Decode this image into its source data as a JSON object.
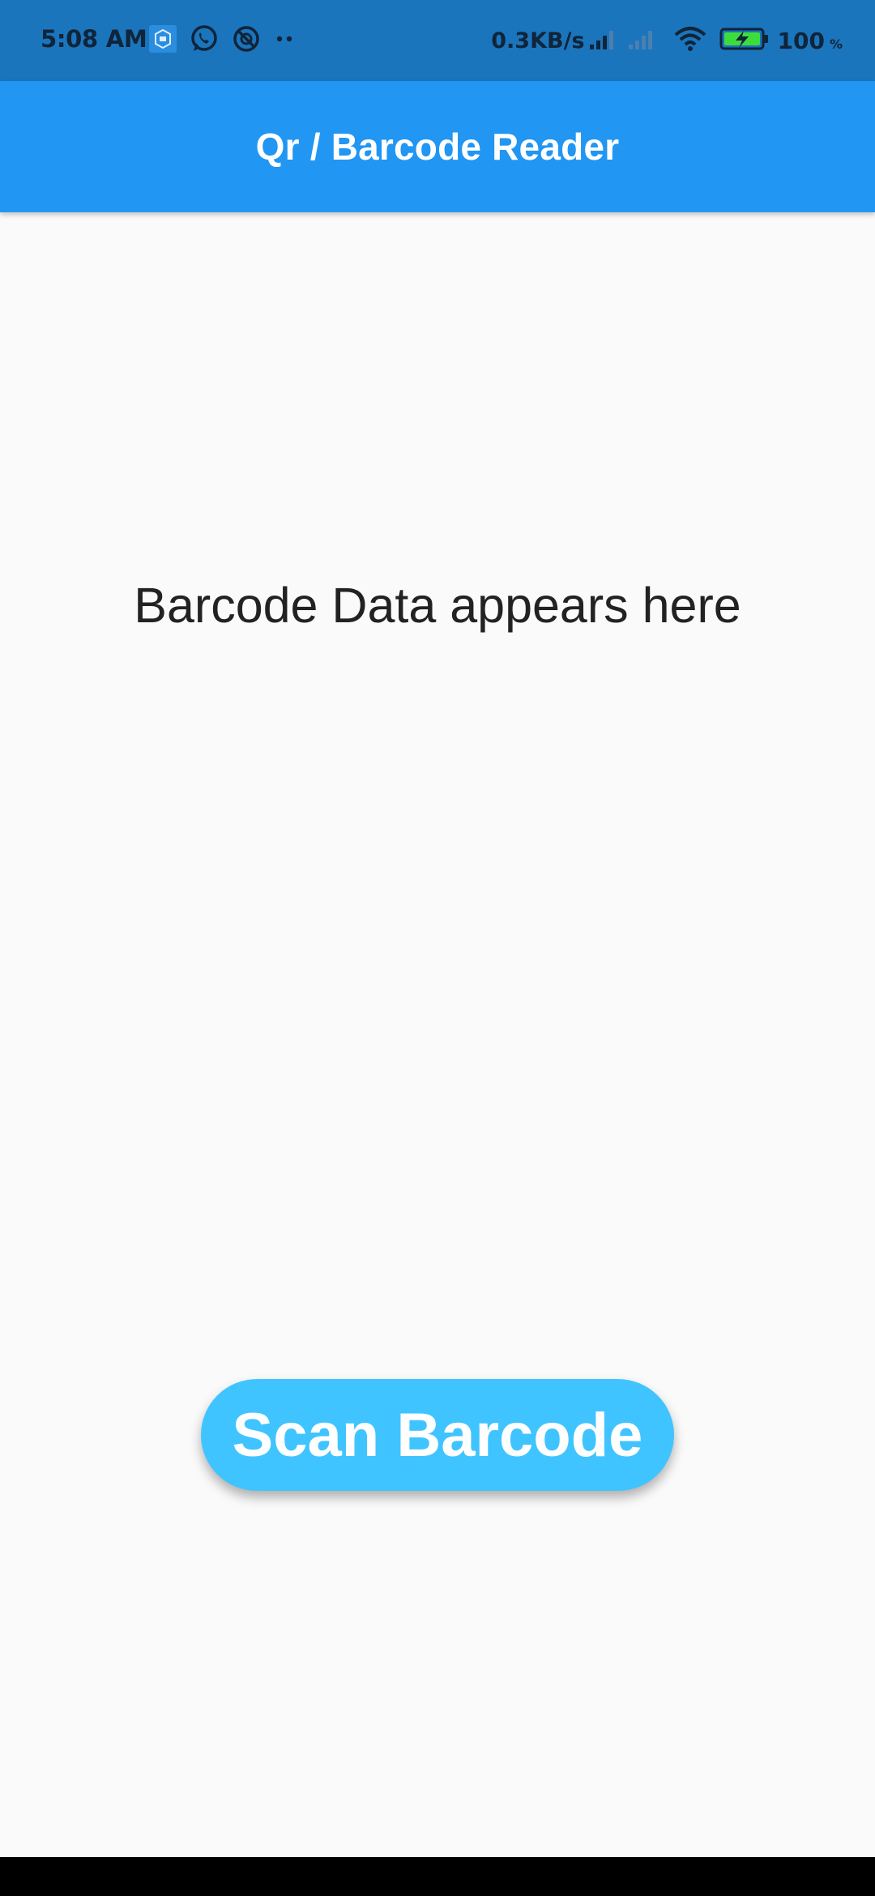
{
  "status_bar": {
    "time": "5:08 AM",
    "left_icons": [
      "mi-app-icon",
      "whatsapp-icon",
      "blocked-icon",
      "more-dots-icon"
    ],
    "net_speed": "0.3KB/s",
    "battery_level": "100",
    "battery_unit": "%",
    "colors": {
      "background": "#1b75bc",
      "battery_fill": "#3ddc3d"
    }
  },
  "app_bar": {
    "title": "Qr / Barcode Reader",
    "color": "#2196f3"
  },
  "main": {
    "barcode_text": "Barcode Data appears here",
    "scan_button_label": "Scan Barcode",
    "scan_button_color": "#40c4ff"
  }
}
